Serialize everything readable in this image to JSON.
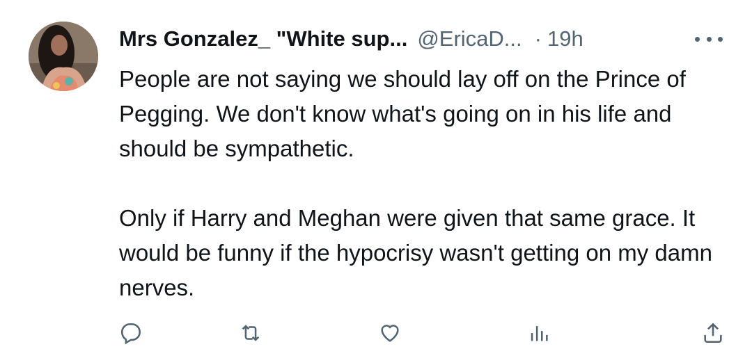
{
  "tweet": {
    "author_name": "Mrs Gonzalez_ \"White sup...",
    "handle": "@EricaD...",
    "separator": "·",
    "time": "19h",
    "text_paragraphs": [
      "People are not saying we should lay off on the Prince of Pegging. We don't know what's going on in his life and should be sympathetic.",
      "Only if Harry and Meghan were given that same grace. It would be funny if the hypocrisy wasn't getting on my damn nerves."
    ]
  },
  "actions": {
    "reply_icon": "reply-icon",
    "retweet_icon": "retweet-icon",
    "like_icon": "like-icon",
    "views_icon": "views-icon",
    "share_icon": "share-icon"
  },
  "colors": {
    "text": "#0f1419",
    "secondary": "#536471",
    "background": "#ffffff"
  }
}
